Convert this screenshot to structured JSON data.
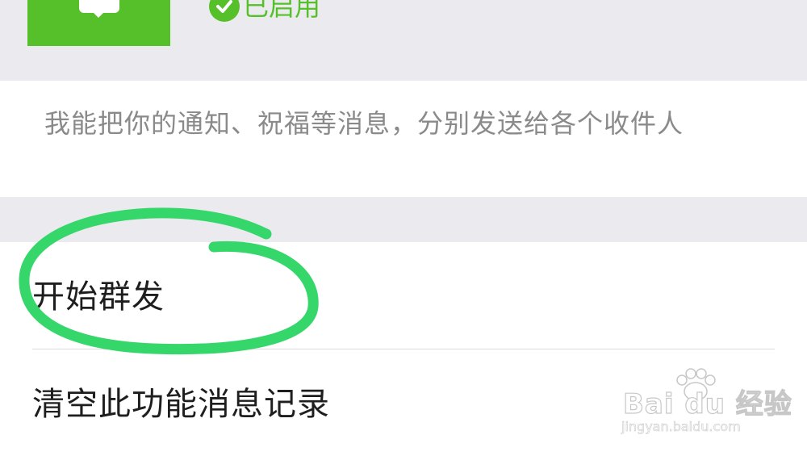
{
  "header": {
    "status_label": "已启用"
  },
  "description": {
    "text": "我能把你的通知、祝福等消息，分别发送给各个收件人"
  },
  "list": {
    "items": [
      {
        "label": "开始群发"
      },
      {
        "label": "清空此功能消息记录"
      }
    ]
  },
  "annotation": {
    "color": "#35d66a"
  },
  "watermark": {
    "brand": "Bai du 经验",
    "url": "jingyan.baidu.com"
  },
  "colors": {
    "accent": "#56c02b",
    "page_background": "#ebebef"
  },
  "icons": {
    "app": "group-message-app-icon",
    "status": "check-circle-icon",
    "watermark": "baidu-paw-icon"
  }
}
